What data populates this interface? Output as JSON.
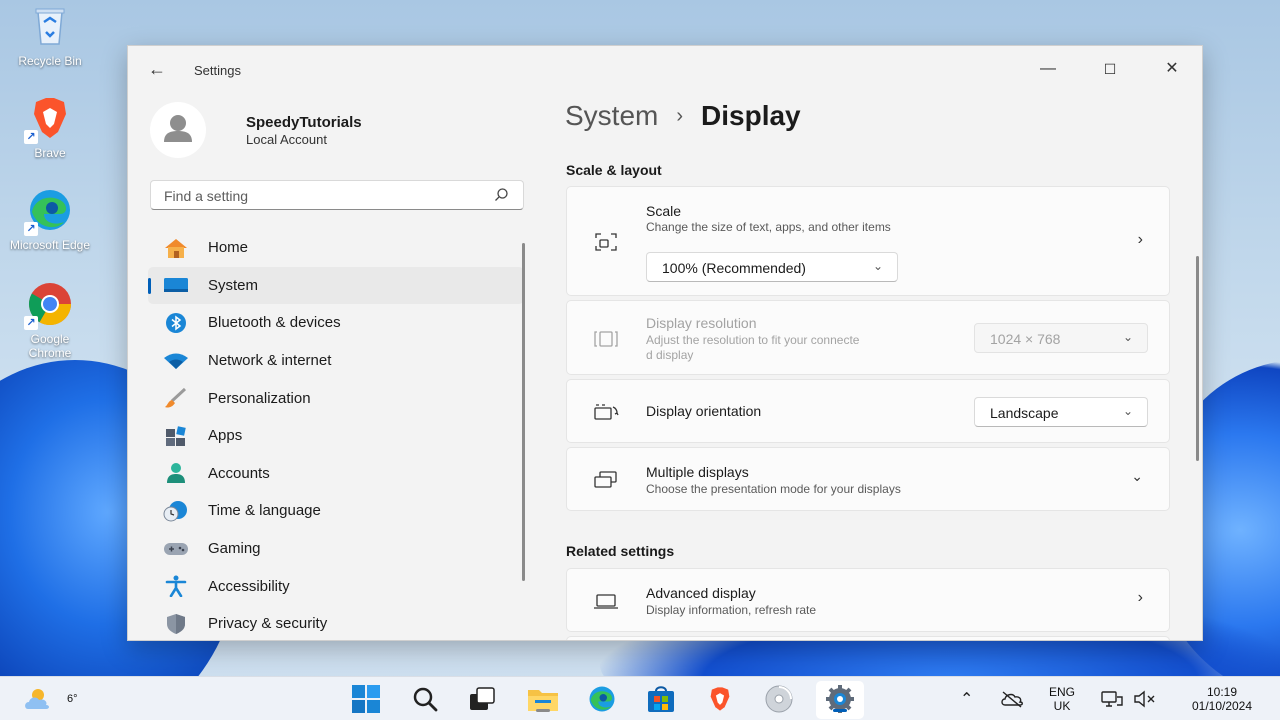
{
  "desktop": {
    "icons": [
      {
        "label": "Recycle Bin",
        "icon": "recycle-bin-icon"
      },
      {
        "label": "Brave",
        "icon": "brave-icon"
      },
      {
        "label": "Microsoft Edge",
        "icon": "edge-icon"
      },
      {
        "label": "Google Chrome",
        "icon": "chrome-icon"
      }
    ]
  },
  "window": {
    "title": "Settings",
    "controls": {
      "minimize": "—",
      "maximize": "☐",
      "close": "✕"
    }
  },
  "profile": {
    "name": "SpeedyTutorials",
    "account_type": "Local Account"
  },
  "search": {
    "placeholder": "Find a setting"
  },
  "nav": {
    "items": [
      {
        "label": "Home",
        "icon": "home-icon"
      },
      {
        "label": "System",
        "icon": "system-icon",
        "active": true
      },
      {
        "label": "Bluetooth & devices",
        "icon": "bluetooth-icon"
      },
      {
        "label": "Network & internet",
        "icon": "wifi-icon"
      },
      {
        "label": "Personalization",
        "icon": "brush-icon"
      },
      {
        "label": "Apps",
        "icon": "apps-icon"
      },
      {
        "label": "Accounts",
        "icon": "accounts-icon"
      },
      {
        "label": "Time & language",
        "icon": "clock-globe-icon"
      },
      {
        "label": "Gaming",
        "icon": "gamepad-icon"
      },
      {
        "label": "Accessibility",
        "icon": "accessibility-icon"
      },
      {
        "label": "Privacy & security",
        "icon": "shield-icon"
      }
    ]
  },
  "breadcrumb": {
    "parent": "System",
    "separator": "›",
    "current": "Display"
  },
  "scale_layout": {
    "heading": "Scale & layout",
    "scale": {
      "title": "Scale",
      "desc": "Change the size of text, apps, and other items",
      "value": "100% (Recommended)"
    },
    "resolution": {
      "title": "Display resolution",
      "desc_line1": "Adjust the resolution to fit your connecte",
      "desc_line2": "d display",
      "value": "1024 × 768"
    },
    "orientation": {
      "title": "Display orientation",
      "value": "Landscape"
    },
    "multiple": {
      "title": "Multiple displays",
      "desc": "Choose the presentation mode for your displays"
    }
  },
  "related": {
    "heading": "Related settings",
    "advanced": {
      "title": "Advanced display",
      "desc": "Display information, refresh rate"
    }
  },
  "taskbar": {
    "weather_temp": "6°",
    "apps": [
      "start-icon",
      "search-icon",
      "task-view-icon",
      "file-explorer-icon",
      "edge-icon",
      "store-icon",
      "brave-icon",
      "disc-icon",
      "settings-gear-icon"
    ],
    "tray": {
      "lang_top": "ENG",
      "lang_bottom": "UK",
      "time": "10:19",
      "date": "01/10/2024"
    }
  },
  "colors": {
    "accent": "#005fb8",
    "window_bg": "#f3f3f3",
    "card_bg": "#fbfbfb"
  }
}
